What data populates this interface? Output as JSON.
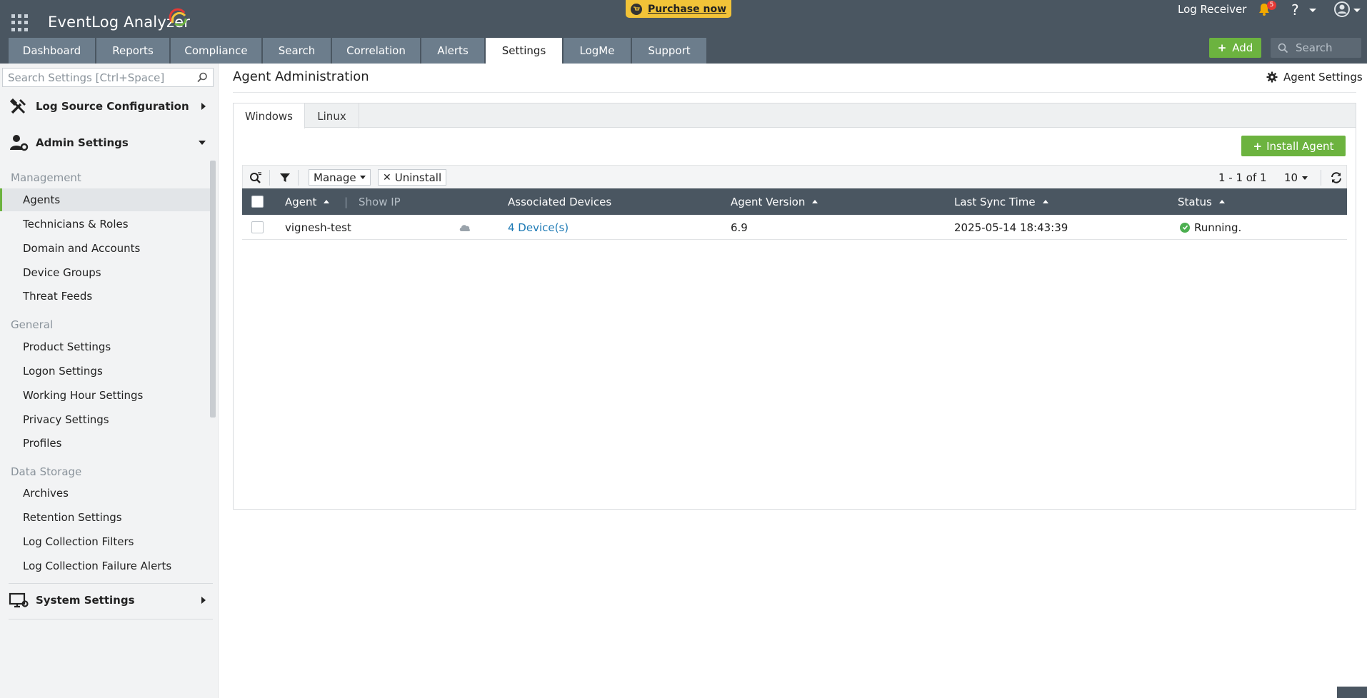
{
  "header": {
    "app_name": "EventLog Analyzer",
    "purchase_label": "Purchase now",
    "log_receiver": "Log Receiver",
    "notification_count": "5",
    "help_label": "?",
    "add_label": "Add",
    "search_placeholder": "Search"
  },
  "nav_tabs": [
    {
      "label": "Dashboard"
    },
    {
      "label": "Reports"
    },
    {
      "label": "Compliance"
    },
    {
      "label": "Search"
    },
    {
      "label": "Correlation"
    },
    {
      "label": "Alerts"
    },
    {
      "label": "Settings",
      "active": true
    },
    {
      "label": "LogMe"
    },
    {
      "label": "Support"
    }
  ],
  "sidebar": {
    "search_placeholder": "Search Settings [Ctrl+Space]",
    "log_source_section": "Log Source Configuration",
    "admin_section": "Admin Settings",
    "system_section": "System Settings",
    "groups": {
      "management": "Management",
      "general": "General",
      "data_storage": "Data Storage"
    },
    "management_items": [
      "Agents",
      "Technicians & Roles",
      "Domain and Accounts",
      "Device Groups",
      "Threat Feeds"
    ],
    "general_items": [
      "Product Settings",
      "Logon Settings",
      "Working Hour Settings",
      "Privacy Settings",
      "Profiles"
    ],
    "storage_items": [
      "Archives",
      "Retention Settings",
      "Log Collection Filters",
      "Log Collection Failure Alerts"
    ],
    "active_item": "Agents"
  },
  "main": {
    "title": "Agent Administration",
    "agent_settings_label": "Agent Settings",
    "os_tabs": [
      "Windows",
      "Linux"
    ],
    "active_os_tab": "Windows",
    "install_label": "Install Agent",
    "toolbar": {
      "manage_label": "Manage",
      "uninstall_label": "Uninstall",
      "page_info": "1 - 1 of 1",
      "per_page": "10"
    },
    "columns": {
      "agent": "Agent",
      "show_ip": "Show IP",
      "devices": "Associated Devices",
      "version": "Agent Version",
      "sync": "Last Sync Time",
      "status": "Status"
    },
    "rows": [
      {
        "agent": "vignesh-test",
        "devices": "4 Device(s)",
        "version": "6.9",
        "sync": "2025-05-14 18:43:39",
        "status": "Running."
      }
    ]
  },
  "colors": {
    "header_bg": "#4a5661",
    "tab_bg": "#6c7d8c",
    "accent_green": "#6cb33f",
    "purchase_yellow": "#f2c338",
    "link_blue": "#1d7ab5"
  }
}
